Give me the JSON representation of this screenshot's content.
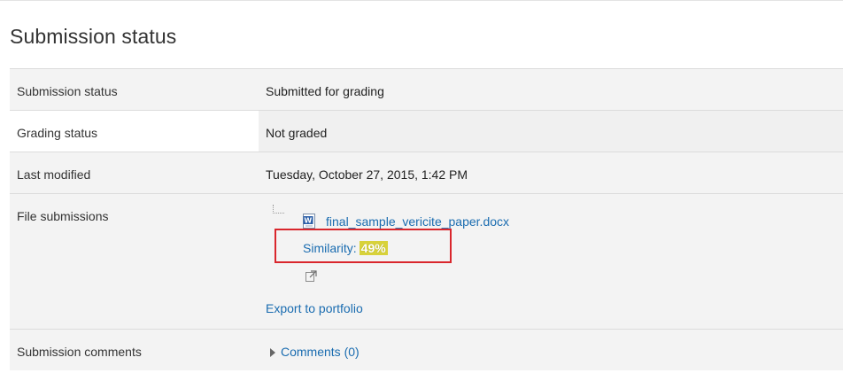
{
  "page": {
    "title": "Submission status"
  },
  "rows": {
    "submission_status": {
      "label": "Submission status",
      "value": "Submitted for grading"
    },
    "grading_status": {
      "label": "Grading status",
      "value": "Not graded"
    },
    "last_modified": {
      "label": "Last modified",
      "value": "Tuesday, October 27, 2015, 1:42 PM"
    },
    "file_submissions": {
      "label": "File submissions",
      "file_name": "final_sample_vericite_paper.docx",
      "file_icon": "word-document-icon",
      "similarity_label": "Similarity:",
      "similarity_score": "49%",
      "portfolio_icon": "portfolio-export-icon",
      "export_link": "Export to portfolio"
    },
    "submission_comments": {
      "label": "Submission comments",
      "comments_link": "Comments (0)"
    }
  },
  "colors": {
    "link": "#1a6cb0",
    "highlight": "#d8d23a",
    "annotation_box": "#d9262c",
    "row_bg": "#f3f3f3"
  }
}
